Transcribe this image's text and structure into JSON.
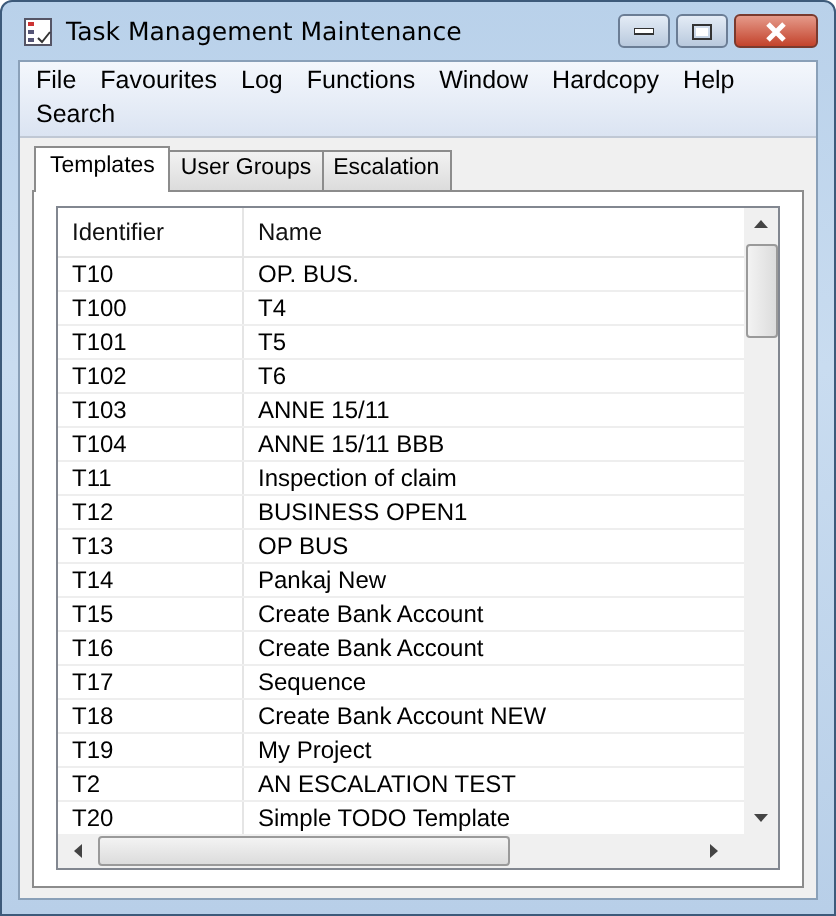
{
  "window": {
    "title": "Task Management Maintenance"
  },
  "menu": [
    "File",
    "Favourites",
    "Log",
    "Functions",
    "Window",
    "Hardcopy",
    "Help",
    "Search"
  ],
  "tabs": [
    {
      "label": "Templates",
      "selected": true
    },
    {
      "label": "User Groups",
      "selected": false
    },
    {
      "label": "Escalation",
      "selected": false
    }
  ],
  "table": {
    "columns": [
      "Identifier",
      "Name"
    ],
    "rows": [
      [
        "T10",
        "OP. BUS."
      ],
      [
        "T100",
        "T4"
      ],
      [
        "T101",
        "T5"
      ],
      [
        "T102",
        "T6"
      ],
      [
        "T103",
        "ANNE 15/11"
      ],
      [
        "T104",
        "ANNE 15/11 BBB"
      ],
      [
        "T11",
        "Inspection of claim"
      ],
      [
        "T12",
        "BUSINESS OPEN1"
      ],
      [
        "T13",
        "OP BUS"
      ],
      [
        "T14",
        "Pankaj New"
      ],
      [
        "T15",
        "Create Bank Account"
      ],
      [
        "T16",
        "Create Bank Account"
      ],
      [
        "T17",
        "Sequence"
      ],
      [
        "T18",
        "Create Bank Account NEW"
      ],
      [
        "T19",
        "My Project"
      ],
      [
        "T2",
        "AN ESCALATION TEST"
      ],
      [
        "T20",
        "Simple TODO Template"
      ]
    ]
  }
}
